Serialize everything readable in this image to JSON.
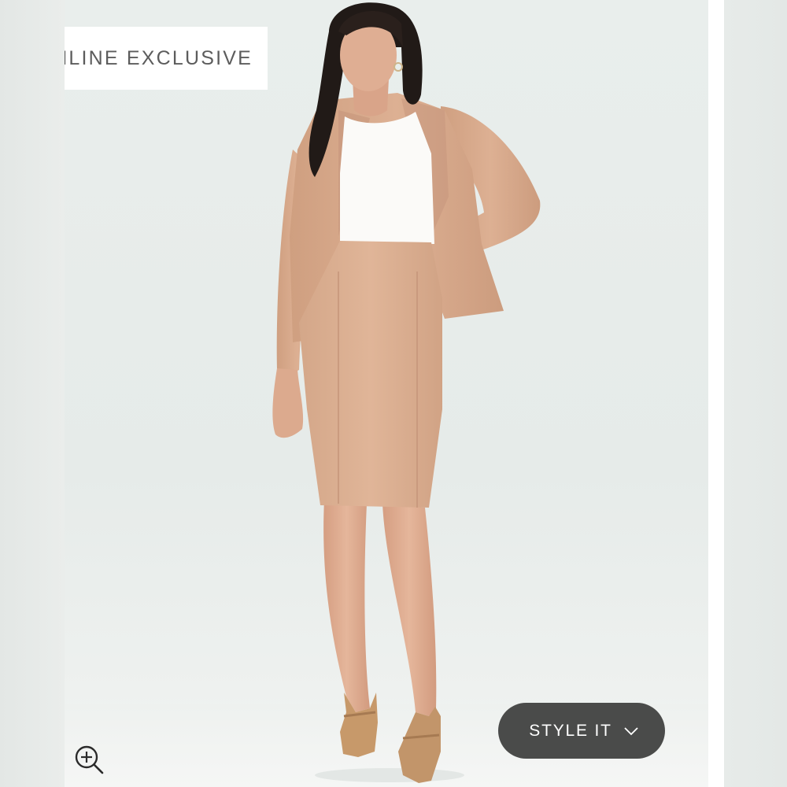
{
  "product_image": {
    "badge_label": "ONLINE EXCLUSIVE",
    "alt": "",
    "colors": {
      "background": "#e9eeec",
      "suit": "#d9ab8c",
      "top": "#fbfaf8",
      "hair": "#211a17",
      "skin": "#dfae93",
      "shoes": "#c69a6c"
    }
  },
  "controls": {
    "zoom_icon": "zoom-in-icon",
    "style_it_label": "STYLE IT",
    "style_it_icon": "chevron-down-icon",
    "style_it_bg": "#4a4b4a"
  }
}
